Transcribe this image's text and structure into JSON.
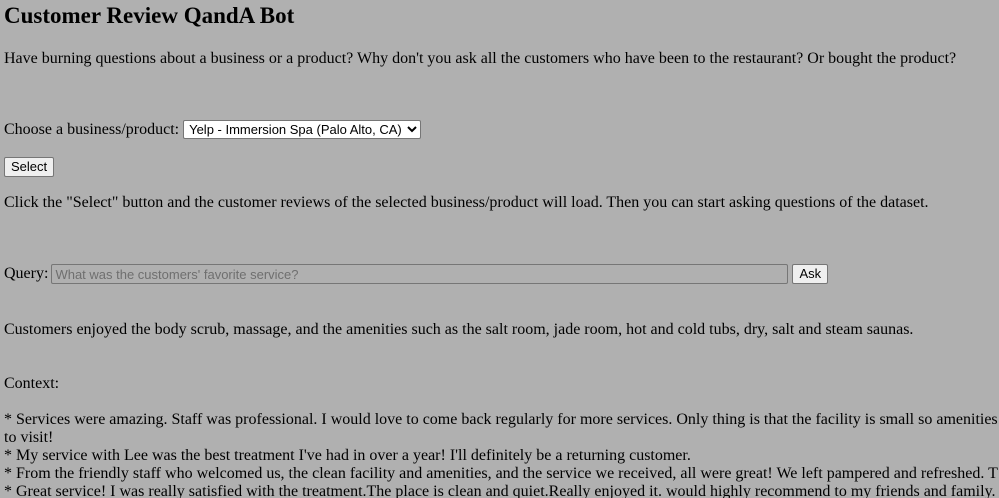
{
  "page": {
    "title": "Customer Review QandA Bot",
    "intro": "Have burning questions about a business or a product? Why don't you ask all the customers who have been to the restaurant? Or bought the product?"
  },
  "selector": {
    "label": "Choose a business/product:",
    "selected": "Yelp - Immersion Spa (Palo Alto, CA)",
    "button_label": "Select"
  },
  "instructions": "Click the \"Select\" button and the customer reviews of the selected business/product will load. Then you can start asking questions of the dataset.",
  "query": {
    "label": "Query:",
    "placeholder": "What was the customers' favorite service?",
    "value": "",
    "button_label": "Ask"
  },
  "answer": "Customers enjoyed the body scrub, massage, and the amenities such as the salt room, jade room, hot and cold tubs, dry, salt and steam saunas.",
  "context": {
    "label": "Context:",
    "lines": [
      "* Services were amazing. Staff was professional. I would love to come back regularly for more services. Only thing is that the facility is small so amenities",
      "to visit!",
      "* My service with Lee was the best treatment I've had in over a year! I'll definitely be a returning customer.",
      "* From the friendly staff who welcomed us, the clean facility and amenities, and the service we received, all were great! We left pampered and refreshed.  T",
      "* Great service! I was really satisfied with the treatment.The place is clean and quiet.Really enjoyed it. would highly recommend to my friends and family."
    ]
  }
}
